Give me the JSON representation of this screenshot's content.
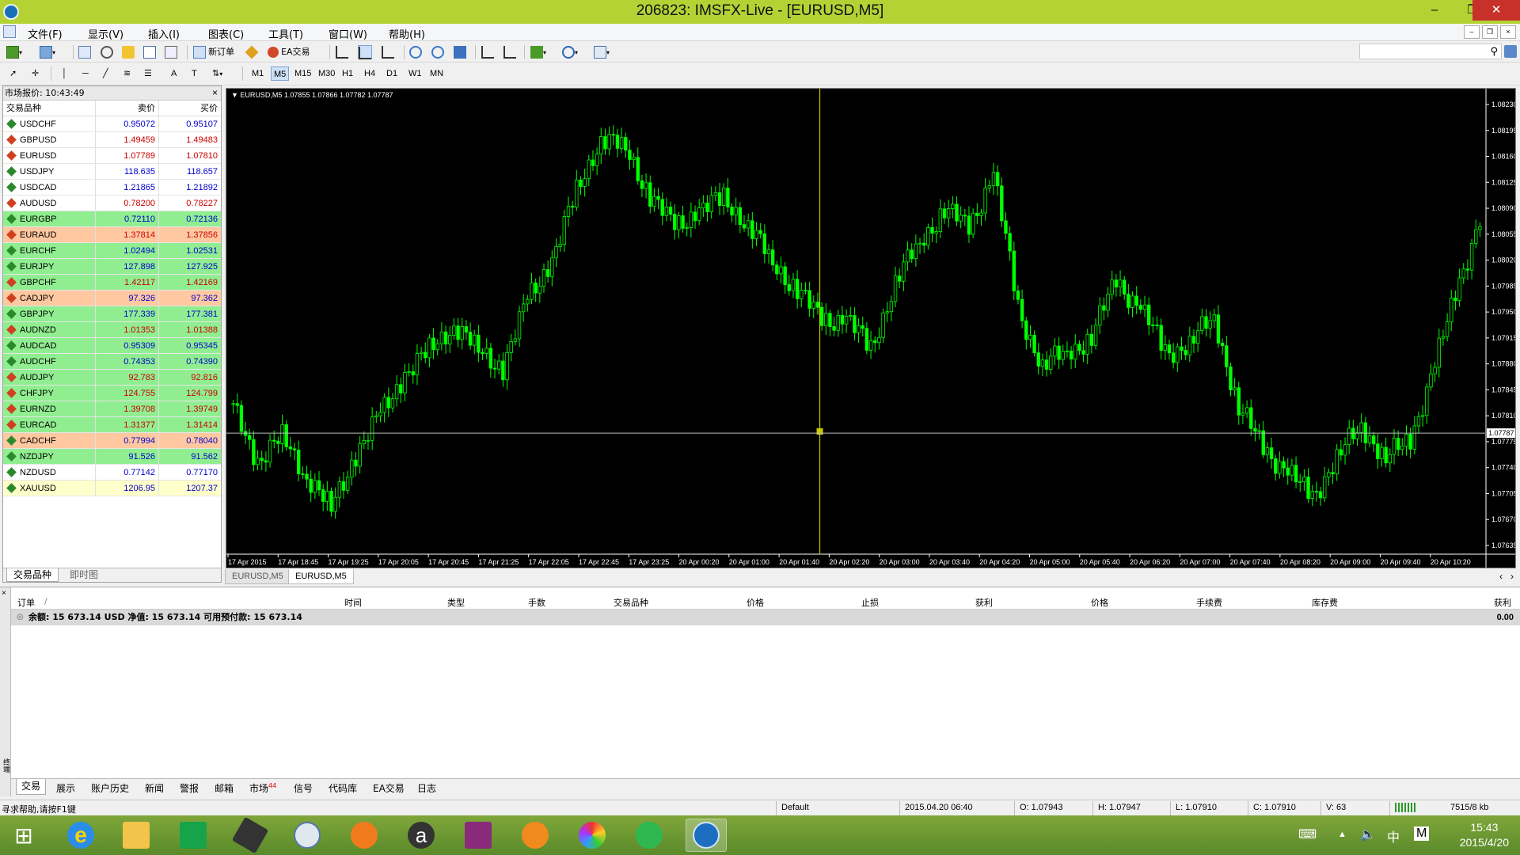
{
  "window": {
    "title": "206823: IMSFX-Live - [EURUSD,M5]",
    "minimize": "–",
    "maximize": "❐",
    "close": "✕"
  },
  "menu": [
    "文件(F)",
    "显示(V)",
    "插入(I)",
    "图表(C)",
    "工具(T)",
    "窗口(W)",
    "帮助(H)"
  ],
  "toolbar": {
    "new_order": "新订单",
    "ea_trading": "EA交易"
  },
  "timeframes": [
    "M1",
    "M5",
    "M15",
    "M30",
    "H1",
    "H4",
    "D1",
    "W1",
    "MN"
  ],
  "market_watch": {
    "title": "市场报价: 10:43:49",
    "close": "×",
    "col_symbol": "交易品种",
    "col_bid": "卖价",
    "col_ask": "买价",
    "tab_symbols": "交易品种",
    "tab_tick": "即时图",
    "rows": [
      {
        "symbol": "USDCHF",
        "bid": "0.95072",
        "ask": "0.95107",
        "dir": "up",
        "bg": "#ffffff",
        "color": "#0000cc"
      },
      {
        "symbol": "GBPUSD",
        "bid": "1.49459",
        "ask": "1.49483",
        "dir": "down",
        "bg": "#ffffff",
        "color": "#cc0000"
      },
      {
        "symbol": "EURUSD",
        "bid": "1.07789",
        "ask": "1.07810",
        "dir": "down",
        "bg": "#ffffff",
        "color": "#cc0000"
      },
      {
        "symbol": "USDJPY",
        "bid": "118.635",
        "ask": "118.657",
        "dir": "up",
        "bg": "#ffffff",
        "color": "#0000cc"
      },
      {
        "symbol": "USDCAD",
        "bid": "1.21865",
        "ask": "1.21892",
        "dir": "up",
        "bg": "#ffffff",
        "color": "#0000cc"
      },
      {
        "symbol": "AUDUSD",
        "bid": "0.78200",
        "ask": "0.78227",
        "dir": "down",
        "bg": "#ffffff",
        "color": "#cc0000"
      },
      {
        "symbol": "EURGBP",
        "bid": "0.72110",
        "ask": "0.72136",
        "dir": "up",
        "bg": "#90ee90",
        "color": "#0000cc"
      },
      {
        "symbol": "EURAUD",
        "bid": "1.37814",
        "ask": "1.37856",
        "dir": "down",
        "bg": "#ffc8a0",
        "color": "#cc0000"
      },
      {
        "symbol": "EURCHF",
        "bid": "1.02494",
        "ask": "1.02531",
        "dir": "up",
        "bg": "#90ee90",
        "color": "#0000cc"
      },
      {
        "symbol": "EURJPY",
        "bid": "127.898",
        "ask": "127.925",
        "dir": "up",
        "bg": "#90ee90",
        "color": "#0000cc"
      },
      {
        "symbol": "GBPCHF",
        "bid": "1.42117",
        "ask": "1.42169",
        "dir": "down",
        "bg": "#90ee90",
        "color": "#cc0000"
      },
      {
        "symbol": "CADJPY",
        "bid": "97.326",
        "ask": "97.362",
        "dir": "down",
        "bg": "#ffc8a0",
        "color": "#0000cc"
      },
      {
        "symbol": "GBPJPY",
        "bid": "177.339",
        "ask": "177.381",
        "dir": "up",
        "bg": "#90ee90",
        "color": "#0000cc"
      },
      {
        "symbol": "AUDNZD",
        "bid": "1.01353",
        "ask": "1.01388",
        "dir": "down",
        "bg": "#90ee90",
        "color": "#cc0000"
      },
      {
        "symbol": "AUDCAD",
        "bid": "0.95309",
        "ask": "0.95345",
        "dir": "up",
        "bg": "#90ee90",
        "color": "#0000cc"
      },
      {
        "symbol": "AUDCHF",
        "bid": "0.74353",
        "ask": "0.74390",
        "dir": "up",
        "bg": "#90ee90",
        "color": "#0000cc"
      },
      {
        "symbol": "AUDJPY",
        "bid": "92.783",
        "ask": "92.816",
        "dir": "down",
        "bg": "#90ee90",
        "color": "#cc0000"
      },
      {
        "symbol": "CHFJPY",
        "bid": "124.755",
        "ask": "124.799",
        "dir": "down",
        "bg": "#90ee90",
        "color": "#cc0000"
      },
      {
        "symbol": "EURNZD",
        "bid": "1.39708",
        "ask": "1.39749",
        "dir": "down",
        "bg": "#90ee90",
        "color": "#cc0000"
      },
      {
        "symbol": "EURCAD",
        "bid": "1.31377",
        "ask": "1.31414",
        "dir": "down",
        "bg": "#90ee90",
        "color": "#cc0000"
      },
      {
        "symbol": "CADCHF",
        "bid": "0.77994",
        "ask": "0.78040",
        "dir": "up",
        "bg": "#ffc8a0",
        "color": "#0000cc"
      },
      {
        "symbol": "NZDJPY",
        "bid": "91.526",
        "ask": "91.562",
        "dir": "up",
        "bg": "#90ee90",
        "color": "#0000cc"
      },
      {
        "symbol": "NZDUSD",
        "bid": "0.77142",
        "ask": "0.77170",
        "dir": "up",
        "bg": "#ffffff",
        "color": "#0000cc"
      },
      {
        "symbol": "XAUUSD",
        "bid": "1206.95",
        "ask": "1207.37",
        "dir": "up",
        "bg": "#ffffcc",
        "color": "#0000cc"
      }
    ]
  },
  "chart": {
    "header": "EURUSD,M5  1.07855 1.07866 1.07782 1.07787",
    "price_labels": [
      "1.08230",
      "1.08195",
      "1.08160",
      "1.08125",
      "1.08090",
      "1.08055",
      "1.08020",
      "1.07985",
      "1.07950",
      "1.07915",
      "1.07880",
      "1.07845",
      "1.07810",
      "1.07775",
      "1.07740",
      "1.07705",
      "1.07670",
      "1.07635"
    ],
    "current_price": "1.07787",
    "time_labels": [
      "17 Apr 2015",
      "17 Apr 18:45",
      "17 Apr 19:25",
      "17 Apr 20:05",
      "17 Apr 20:45",
      "17 Apr 21:25",
      "17 Apr 22:05",
      "17 Apr 22:45",
      "17 Apr 23:25",
      "20 Apr 00:20",
      "20 Apr 01:00",
      "20 Apr 01:40",
      "20 Apr 02:20",
      "20 Apr 03:00",
      "20 Apr 03:40",
      "20 Apr 04:20",
      "20 Apr 05:00",
      "20 Apr 05:40",
      "20 Apr 06:20",
      "20 Apr 07:00",
      "20 Apr 07:40",
      "20 Apr 08:20",
      "20 Apr 09:00",
      "20 Apr 09:40",
      "20 Apr 10:20"
    ],
    "colors": {
      "bg": "#000000",
      "candle": "#00ff00",
      "separator": "#c8c800",
      "price_line": "#c0c0c0"
    },
    "tabs": [
      "EURUSD,M5",
      "EURUSD,M5"
    ],
    "scroll_left": "‹",
    "scroll_right": "›",
    "chart_data": {
      "type": "candlestick",
      "symbol": "EURUSD",
      "timeframe": "M5",
      "ylim": [
        1.0762,
        1.0825
      ],
      "approx_closes": [
        1.0782,
        1.0775,
        1.0778,
        1.0773,
        1.0768,
        1.0776,
        1.0781,
        1.0787,
        1.079,
        1.0794,
        1.079,
        1.0788,
        1.0797,
        1.0803,
        1.0812,
        1.082,
        1.0818,
        1.0812,
        1.0807,
        1.081,
        1.0811,
        1.0808,
        1.0802,
        1.0799,
        1.0794,
        1.0795,
        1.079,
        1.08,
        1.0805,
        1.081,
        1.0807,
        1.0815,
        1.0796,
        1.0788,
        1.079,
        1.0792,
        1.08,
        1.0796,
        1.079,
        1.0791,
        1.0795,
        1.0782,
        1.0777,
        1.0773,
        1.077,
        1.0775,
        1.078,
        1.0775,
        1.0778,
        1.0788,
        1.08,
        1.081
      ]
    }
  },
  "terminal": {
    "columns": [
      "订单",
      "/",
      "时间",
      "类型",
      "手数",
      "交易品种",
      "价格",
      "止损",
      "获利",
      "价格",
      "手续费",
      "库存费",
      "获利"
    ],
    "balance_line": "余额: 15 673.14 USD  净值: 15 673.14  可用预付款: 15 673.14",
    "balance_profit": "0.00",
    "side_label": "终端",
    "tabs": [
      "交易",
      "展示",
      "账户历史",
      "新闻",
      "警报",
      "邮箱",
      "市场",
      "信号",
      "代码库",
      "EA交易",
      "日志"
    ],
    "market_badge": "44"
  },
  "status": {
    "help": "寻求帮助,请按F1键",
    "profile": "Default",
    "datetime": "2015.04.20 06:40",
    "open": "O: 1.07943",
    "high": "H: 1.07947",
    "low": "L: 1.07910",
    "close": "C: 1.07910",
    "volume": "V: 63",
    "traffic": "7515/8 kb"
  },
  "taskbar": {
    "time": "15:43",
    "date": "2015/4/20",
    "ime_lang": "中",
    "ime_mode": "M",
    "apps": [
      "windows-start",
      "ie",
      "explorer",
      "store",
      "app-4",
      "ifly",
      "app-6",
      "amazon",
      "pdf",
      "uc-browser",
      "app-10",
      "app-11",
      "metatrader"
    ]
  }
}
